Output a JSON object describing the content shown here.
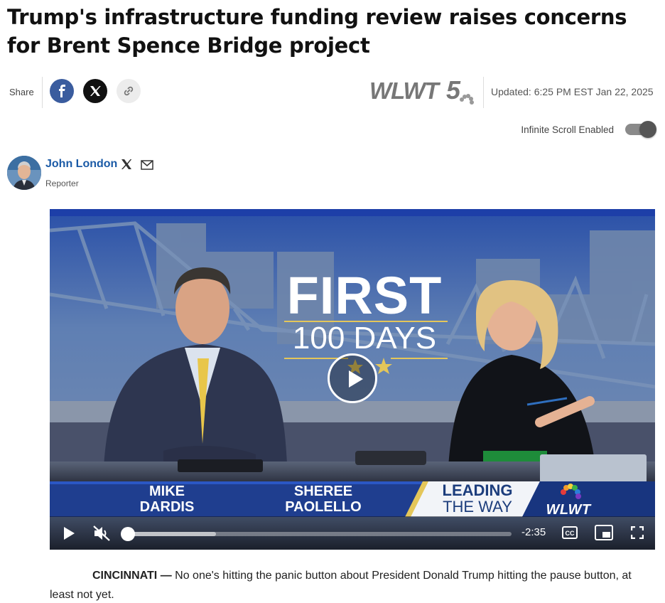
{
  "article": {
    "headline": "Trump's infrastructure funding review raises concerns for Brent Spence Bridge project",
    "updated": "Updated: 6:25 PM EST Jan 22, 2025",
    "dateline": "CINCINNATI —",
    "lede": "No one's hitting the panic button about President Donald Trump hitting the pause button, at least not yet."
  },
  "share": {
    "label": "Share",
    "buttons": [
      {
        "name": "facebook",
        "icon": "facebook-icon"
      },
      {
        "name": "x",
        "icon": "x-icon"
      },
      {
        "name": "copy-link",
        "icon": "link-icon"
      }
    ]
  },
  "brand": {
    "logo_text": "WLWT",
    "logo_number": "5",
    "accent_color": "#1a5aa6"
  },
  "infinite_scroll": {
    "label": "Infinite Scroll Enabled",
    "enabled": true
  },
  "author": {
    "name": "John London",
    "role": "Reporter",
    "icons": [
      "x-icon",
      "mail-icon"
    ]
  },
  "video": {
    "graphic_title": "FIRST",
    "graphic_subtitle": "100 DAYS",
    "lower_third": {
      "name1_first": "MIKE",
      "name1_last": "DARDIS",
      "name2_first": "SHEREE",
      "name2_last": "PAOLELLO",
      "tagline_top": "LEADING",
      "tagline_bottom": "THE WAY",
      "station": "WLWT"
    },
    "controls": {
      "time_remaining": "-2:35",
      "muted": true,
      "progress_fraction": 0.0,
      "buffered_fraction": 0.23,
      "icons": [
        "play-icon",
        "mute-icon",
        "closed-captions-icon",
        "picture-in-picture-icon",
        "fullscreen-icon"
      ]
    }
  }
}
